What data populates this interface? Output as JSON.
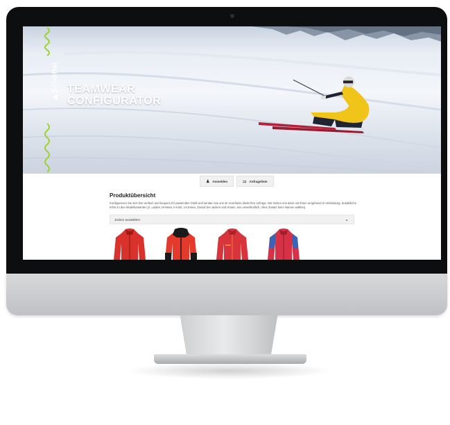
{
  "hero": {
    "brand": "Schöffel",
    "title_line1": "TEAMWEAR",
    "title_line2": "CONFIGURATOR"
  },
  "actions": {
    "login_label": "Anmelden",
    "cart_label": "Anfrageliste"
  },
  "main": {
    "section_title": "Produktübersicht",
    "description": "Konfigurieren Sie sich hier einfach und bequem Ihr passendes Outfit und senden Sie uns im Anschluss direkt Ihre Anfrage. Wir setzen uns dann mit Ihnen umgehend in Verbindung. Zusätzliche Infos zu den Modellvarianten (z. Ladies, M-Wear, K-Kids, U-Unisex, Zusatz bei Jacken und Hosen, sex unverbindlich, ohne Zusatz beim Namen wählen).",
    "dropdown_value": "Jacken auswählen"
  },
  "products": [
    {
      "name": "jacket-1",
      "color": "#d9312b",
      "accent": "#c02620"
    },
    {
      "name": "jacket-2",
      "color": "#e43a2c",
      "accent": "#1a1a1a"
    },
    {
      "name": "jacket-3",
      "color": "#d8343b",
      "accent": "#f07a40"
    },
    {
      "name": "jacket-4",
      "color": "#d63145",
      "accent": "#3a64b5"
    }
  ],
  "colors": {
    "accent_green": "#9bd32d",
    "skier_yellow": "#f0c419"
  }
}
